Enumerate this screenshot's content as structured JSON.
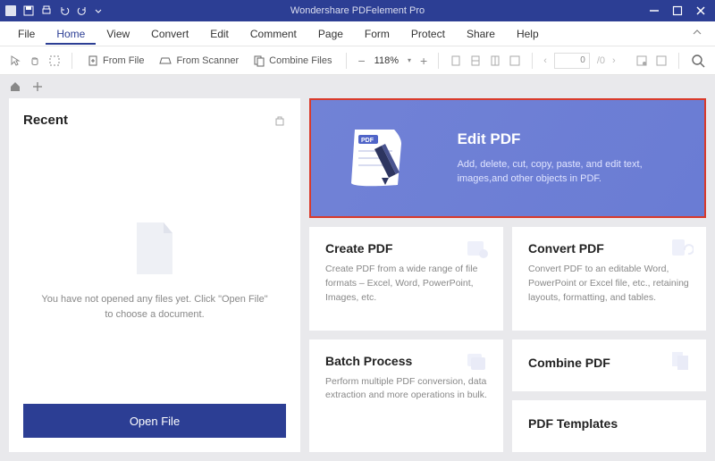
{
  "window": {
    "title": "Wondershare PDFelement Pro"
  },
  "menu": {
    "items": [
      "File",
      "Home",
      "View",
      "Convert",
      "Edit",
      "Comment",
      "Page",
      "Form",
      "Protect",
      "Share",
      "Help"
    ],
    "active_index": 1
  },
  "toolbar": {
    "from_file": "From File",
    "from_scanner": "From Scanner",
    "combine_files": "Combine Files",
    "zoom_pct": "118%",
    "page_input": "0",
    "page_total": "/0"
  },
  "recent": {
    "title": "Recent",
    "empty_msg": "You have not opened any files yet. Click \"Open File\" to choose a document.",
    "open_btn": "Open File"
  },
  "hero": {
    "title": "Edit PDF",
    "desc": "Add, delete, cut, copy, paste, and edit text, images,and other objects in PDF."
  },
  "cards": {
    "create": {
      "title": "Create PDF",
      "desc": "Create PDF from a wide range of file formats – Excel, Word, PowerPoint, Images, etc."
    },
    "convert": {
      "title": "Convert PDF",
      "desc": "Convert PDF to an editable Word, PowerPoint or Excel file, etc., retaining layouts, formatting, and tables."
    },
    "batch": {
      "title": "Batch Process",
      "desc": "Perform multiple PDF conversion, data extraction and more operations in bulk."
    },
    "combine": {
      "title": "Combine PDF"
    },
    "templates": {
      "title": "PDF Templates"
    }
  }
}
